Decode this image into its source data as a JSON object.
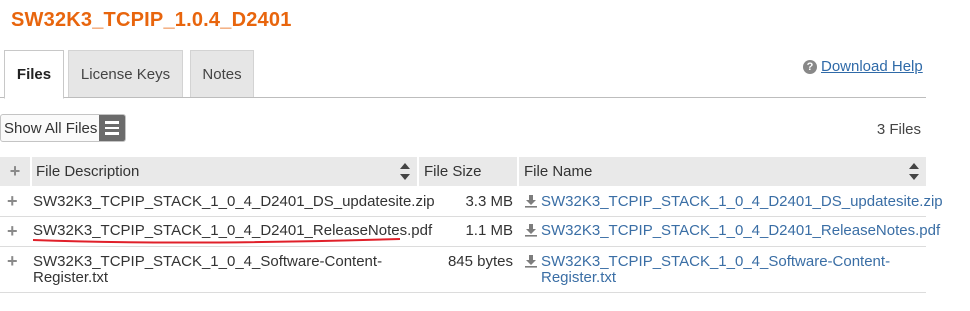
{
  "page_title": "SW32K3_TCPIP_1.0.4_D2401",
  "tabs": [
    {
      "label": "Files",
      "active": true
    },
    {
      "label": "License Keys",
      "active": false
    },
    {
      "label": "Notes",
      "active": false
    }
  ],
  "help": {
    "icon": "question-circle-icon",
    "label": "Download Help"
  },
  "toolbar": {
    "show_all_label": "Show All Files",
    "menu_icon": "hamburger-menu-icon"
  },
  "file_count": "3 Files",
  "table": {
    "columns": [
      "File Description",
      "File Size",
      "File Name"
    ],
    "rows": [
      {
        "description": "SW32K3_TCPIP_STACK_1_0_4_D2401_DS_updatesite.zip",
        "size": "3.3 MB",
        "file_name": "SW32K3_TCPIP_STACK_1_0_4_D2401_DS_updatesite.zip"
      },
      {
        "description": "SW32K3_TCPIP_STACK_1_0_4_D2401_ReleaseNotes.pdf",
        "size": "1.1 MB",
        "file_name": "SW32K3_TCPIP_STACK_1_0_4_D2401_ReleaseNotes.pdf"
      },
      {
        "description_line1": "SW32K3_TCPIP_STACK_1_0_4_Software-Content-",
        "description_line2": "Register.txt",
        "size": "845 bytes",
        "file_name_line1": "SW32K3_TCPIP_STACK_1_0_4_Software-Content-",
        "file_name_line2": "Register.txt"
      }
    ]
  },
  "colors": {
    "title": "#e8650d",
    "link": "#3a6ea5",
    "annotation": "#e0202a"
  }
}
